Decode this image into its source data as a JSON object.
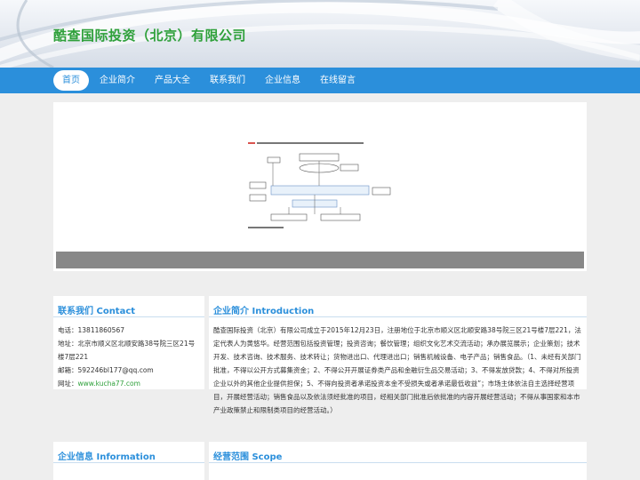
{
  "site": {
    "title": "酷查国际投资（北京）有限公司"
  },
  "nav": {
    "items": [
      {
        "label": "首页",
        "active": true
      },
      {
        "label": "企业简介"
      },
      {
        "label": "产品大全"
      },
      {
        "label": "联系我们"
      },
      {
        "label": "企业信息"
      },
      {
        "label": "在线留言"
      }
    ]
  },
  "contact": {
    "heading": "联系我们 Contact",
    "phone": "电话：13811860567",
    "address": "地址：北京市顺义区北顺安路38号院三区21号楼7层221",
    "email": "邮箱：592246bl177@qq.com",
    "website_label": "网址：",
    "website_link": "www.kucha77.com"
  },
  "intro": {
    "heading": "企业简介 Introduction",
    "text": "酷查国际投资（北京）有限公司成立于2015年12月23日，注册地位于北京市顺义区北顺安路38号院三区21号楼7层221，法定代表人为黄悠华。经营范围包括投资管理；投资咨询；餐饮管理；组织文化艺术交流活动；承办展览展示；企业策划；技术开发、技术咨询、技术服务、技术转让；货物进出口、代理进出口；销售机械设备、电子产品；销售食品。（1、未经有关部门批准，不得以公开方式募集资金；2、不得公开开展证券类产品和金融衍生品交易活动；3、不得发放贷款；4、不得对所投资企业以外的其他企业提供担保；5、不得向投资者承诺投资本金不受损失或者承诺最低收益”；市场主体依法自主选择经营项目，开展经营活动；销售食品以及依法须经批准的项目，经相关部门批准后依批准的内容开展经营活动；不得从事国家和本市产业政策禁止和限制类项目的经营活动。）"
  },
  "info": {
    "heading": "企业信息 Information"
  },
  "scope": {
    "heading": "经营范围 Scope"
  },
  "colors": {
    "accent": "#2b8fdb",
    "title_green": "#2ea03a",
    "banner_bar": "#888888"
  }
}
